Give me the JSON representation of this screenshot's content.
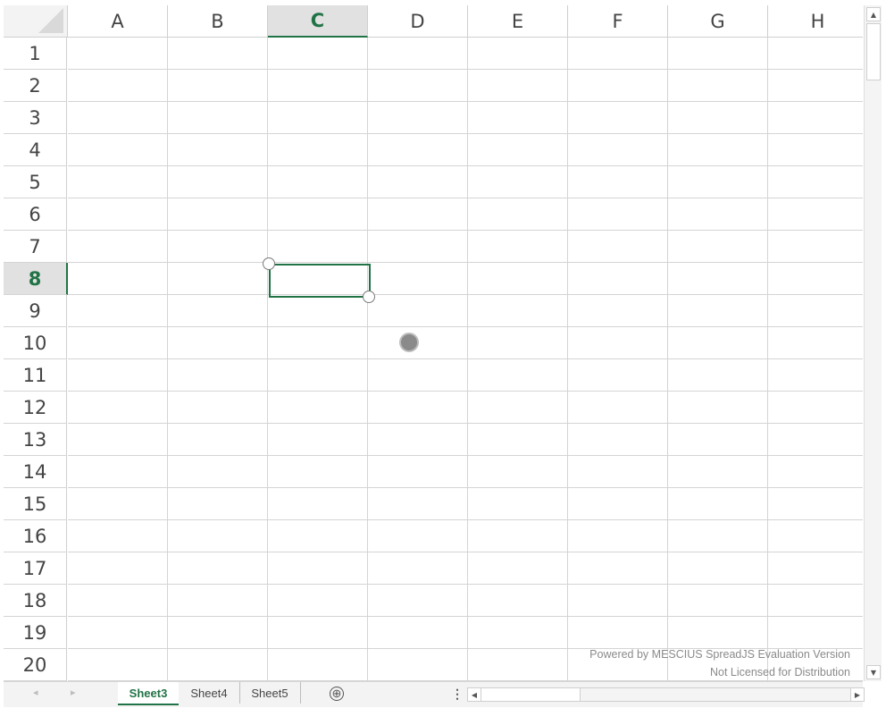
{
  "columns": [
    "A",
    "B",
    "C",
    "D",
    "E",
    "F",
    "G",
    "H"
  ],
  "rows": [
    "1",
    "2",
    "3",
    "4",
    "5",
    "6",
    "7",
    "8",
    "9",
    "10",
    "11",
    "12",
    "13",
    "14",
    "15",
    "16",
    "17",
    "18",
    "19",
    "20"
  ],
  "selection": {
    "active_column": "C",
    "active_row": "8"
  },
  "watermark": {
    "line1": "Powered by MESCIUS SpreadJS Evaluation Version",
    "line2": "Not Licensed for Distribution"
  },
  "tabs": [
    {
      "label": "Sheet3",
      "active": true
    },
    {
      "label": "Sheet4",
      "active": false
    },
    {
      "label": "Sheet5",
      "active": false
    }
  ],
  "icons": {
    "add_sheet": "⊕",
    "more": "⋮",
    "nav_prev": "◂",
    "nav_next": "▸",
    "scroll_up": "▲",
    "scroll_down": "▼",
    "scroll_left": "◀",
    "scroll_right": "▶"
  },
  "colors": {
    "accent": "#217346",
    "header_active_bg": "#e1e1e1",
    "gridline": "#d4d4d4"
  }
}
